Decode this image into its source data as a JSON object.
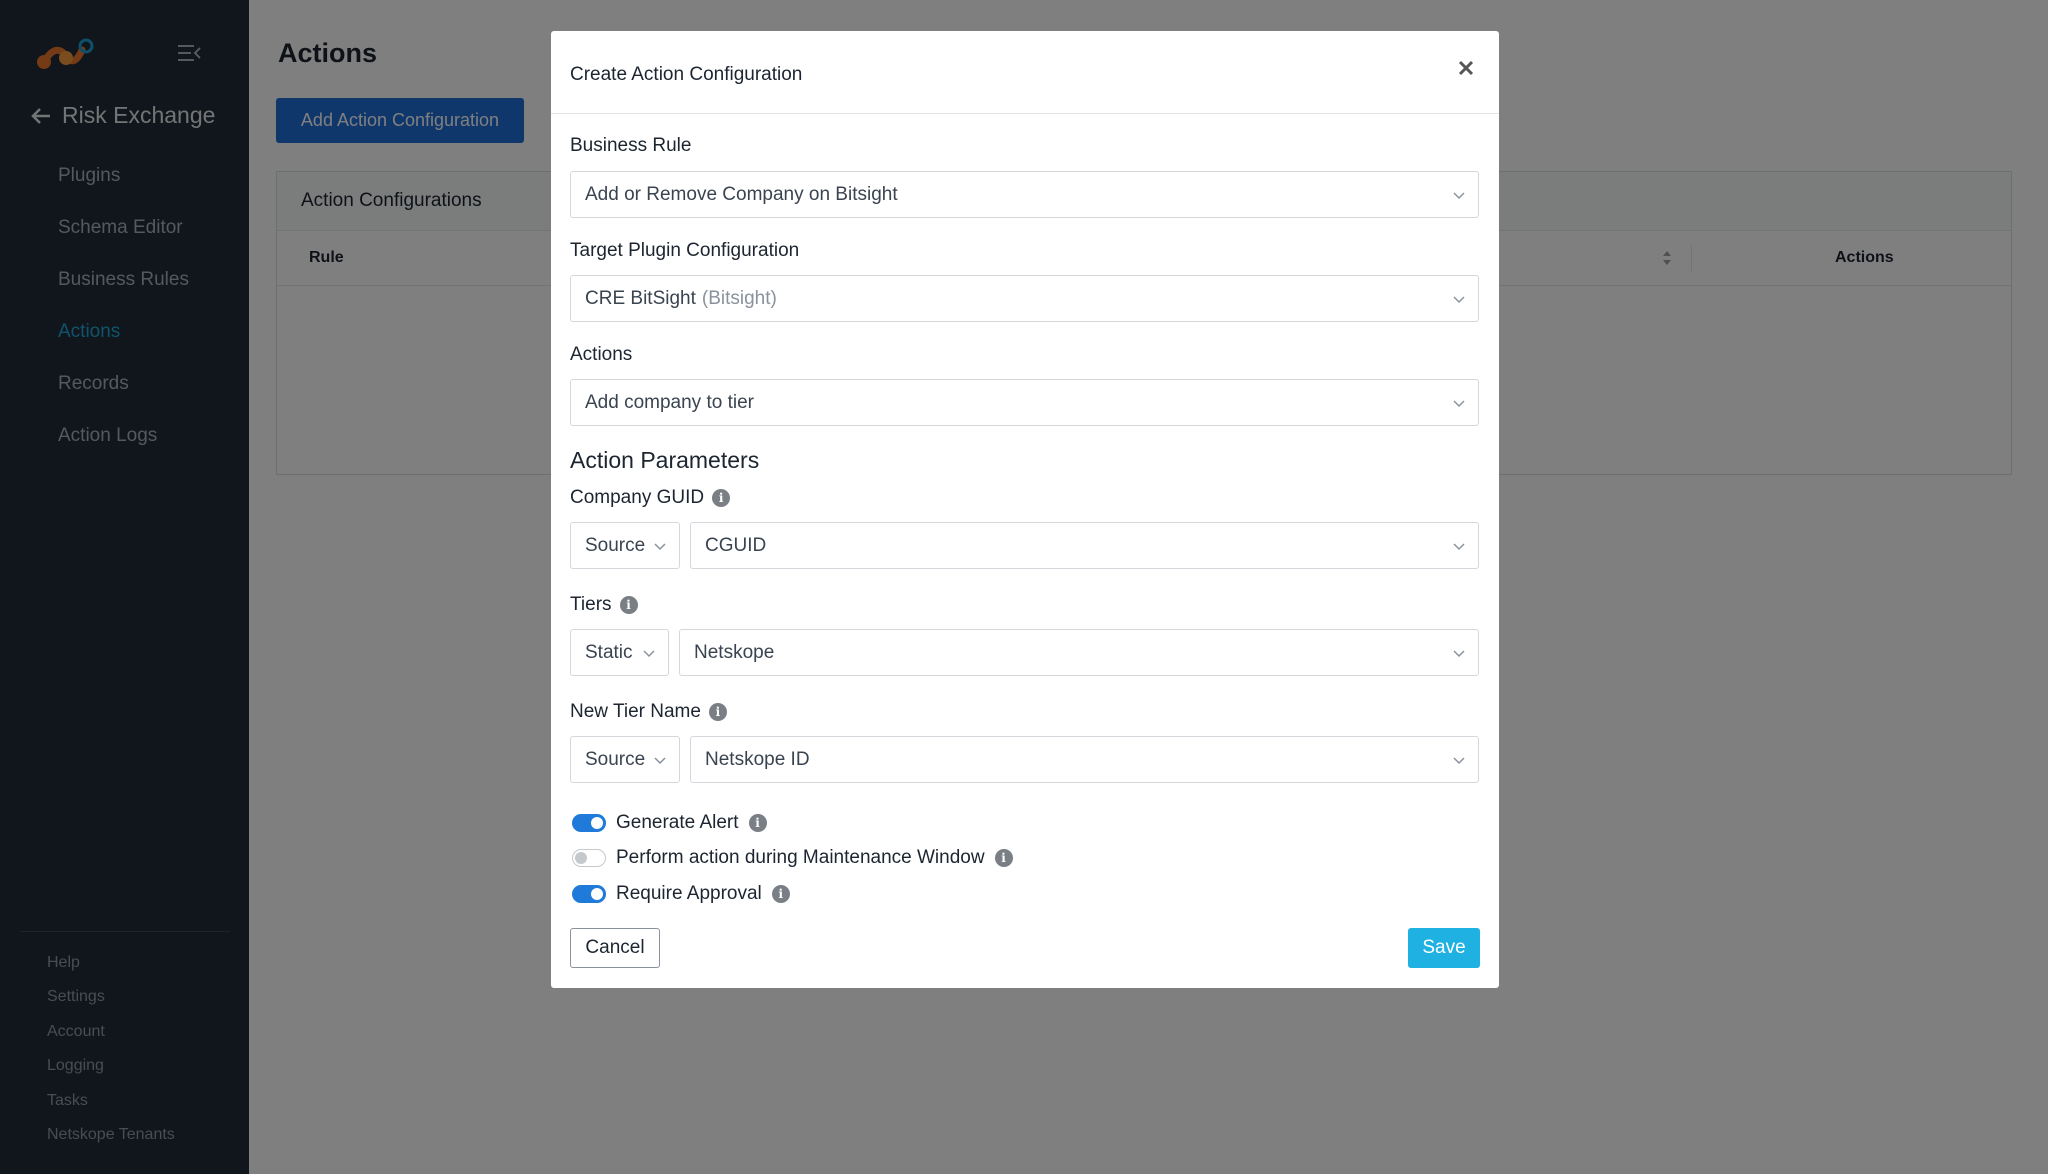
{
  "sidebar": {
    "back_label": "Risk Exchange",
    "items": [
      {
        "label": "Plugins"
      },
      {
        "label": "Schema Editor"
      },
      {
        "label": "Business Rules"
      },
      {
        "label": "Actions",
        "active": true
      },
      {
        "label": "Records"
      },
      {
        "label": "Action Logs"
      }
    ],
    "bottom_items": [
      {
        "label": "Help"
      },
      {
        "label": "Settings"
      },
      {
        "label": "Account"
      },
      {
        "label": "Logging"
      },
      {
        "label": "Tasks"
      },
      {
        "label": "Netskope Tenants"
      }
    ]
  },
  "page": {
    "title": "Actions",
    "add_button": "Add Action Configuration",
    "card_title": "Action Configurations",
    "columns": {
      "rule": "Rule",
      "actions": "Actions"
    }
  },
  "modal": {
    "title": "Create Action Configuration",
    "business_rule": {
      "label": "Business Rule",
      "value": "Add or Remove Company on Bitsight"
    },
    "target_plugin": {
      "label": "Target Plugin Configuration",
      "value": "CRE BitSight",
      "sub": "(Bitsight)"
    },
    "actions": {
      "label": "Actions",
      "value": "Add company to tier"
    },
    "params_title": "Action Parameters",
    "company_guid": {
      "label": "Company GUID",
      "type": "Source",
      "value": "CGUID"
    },
    "tiers": {
      "label": "Tiers",
      "type": "Static",
      "value": "Netskope"
    },
    "new_tier_name": {
      "label": "New Tier Name",
      "type": "Source",
      "value": "Netskope ID"
    },
    "toggles": [
      {
        "label": "Generate Alert",
        "on": true
      },
      {
        "label": "Perform action during Maintenance Window",
        "on": false
      },
      {
        "label": "Require Approval",
        "on": true
      }
    ],
    "cancel_label": "Cancel",
    "save_label": "Save"
  },
  "colors": {
    "sidebar": "#212c37",
    "accent": "#1f6fd8",
    "active_nav": "#21a7d8",
    "save": "#1fb1e2"
  }
}
